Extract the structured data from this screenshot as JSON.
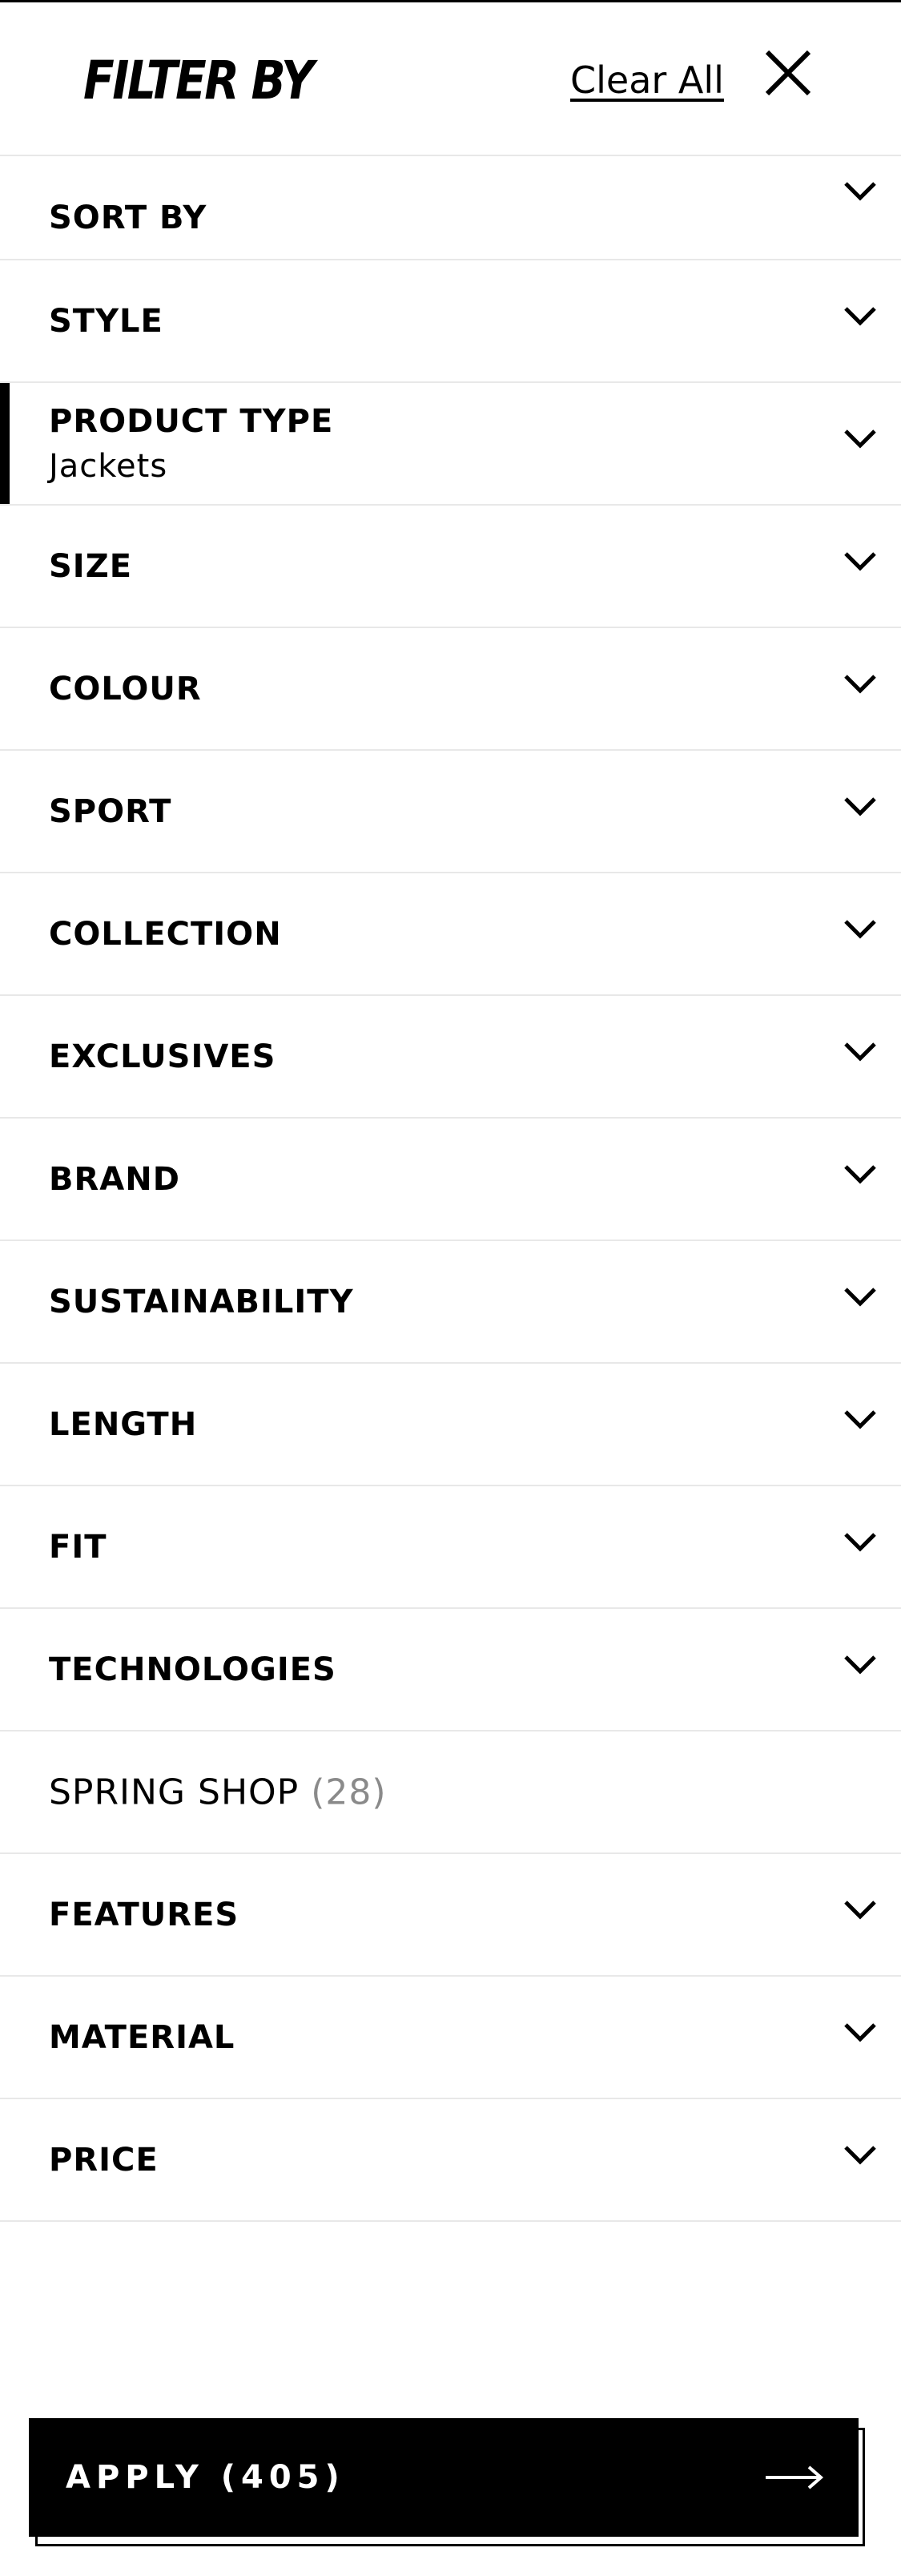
{
  "header": {
    "title": "FILTER BY",
    "clear_all": "Clear All",
    "close_icon": "close-icon"
  },
  "filters": [
    {
      "label": "SORT BY"
    },
    {
      "label": "STYLE"
    },
    {
      "label": "PRODUCT TYPE",
      "value": "Jackets",
      "active": true
    },
    {
      "label": "SIZE"
    },
    {
      "label": "COLOUR"
    },
    {
      "label": "SPORT"
    },
    {
      "label": "COLLECTION"
    },
    {
      "label": "EXCLUSIVES"
    },
    {
      "label": "BRAND"
    },
    {
      "label": "SUSTAINABILITY"
    },
    {
      "label": "LENGTH"
    },
    {
      "label": "FIT"
    },
    {
      "label": "TECHNOLOGIES"
    },
    {
      "label": "SPRING SHOP",
      "count": "(28)"
    },
    {
      "label": "FEATURES"
    },
    {
      "label": "MATERIAL"
    },
    {
      "label": "PRICE"
    }
  ],
  "apply": {
    "label": "APPLY (405)",
    "icon": "arrow-right-icon"
  },
  "colors": {
    "text": "#000000",
    "background": "#ffffff",
    "divider": "#e8e8e8",
    "muted": "#8a8a8a"
  }
}
